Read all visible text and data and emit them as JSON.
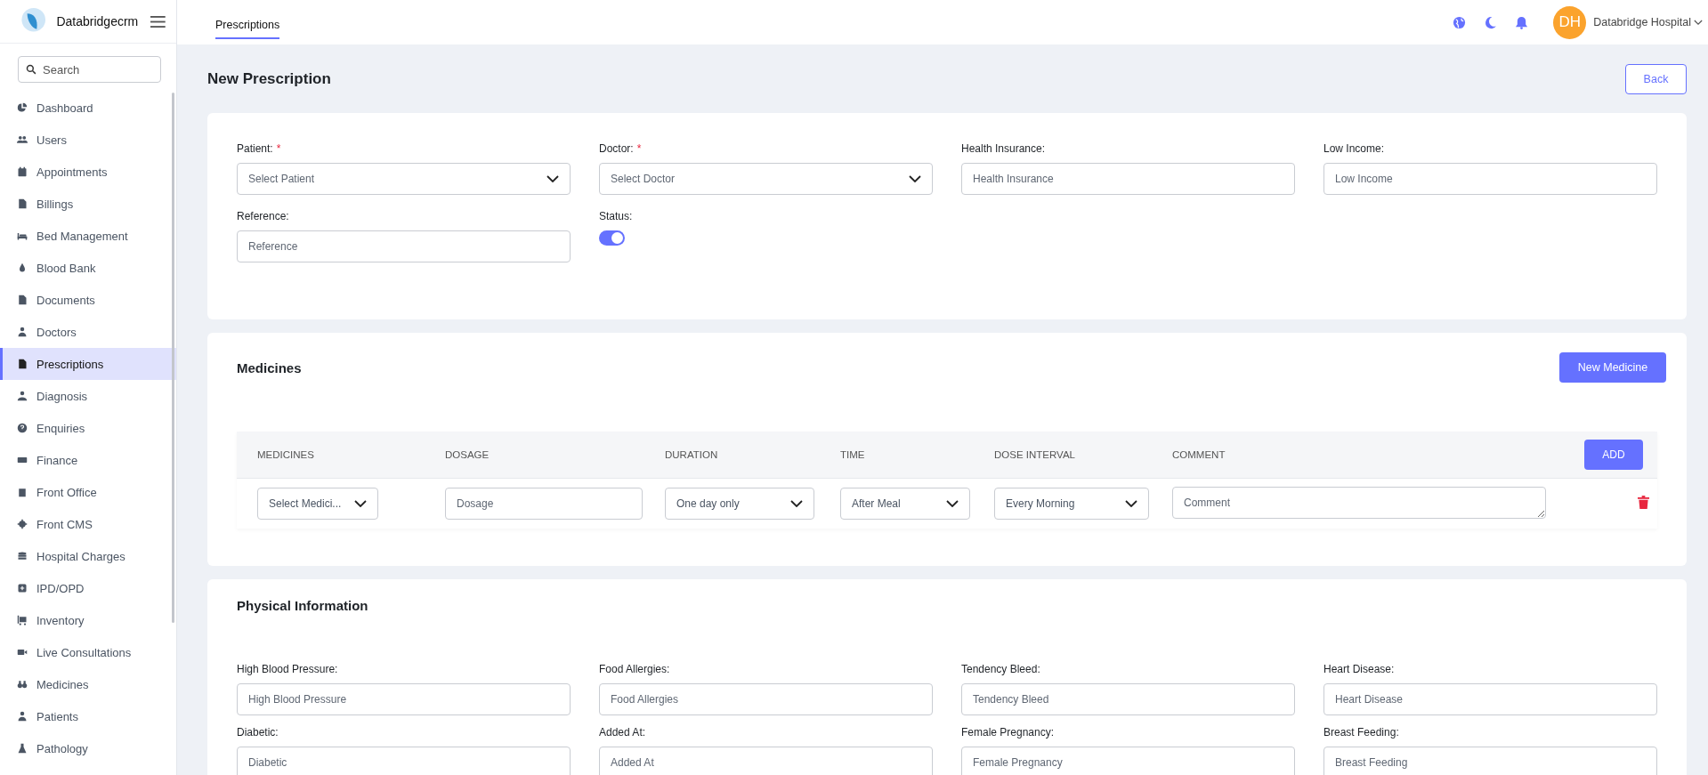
{
  "sidebar": {
    "brand": "Databridgecrm",
    "search": {
      "placeholder": "Search"
    },
    "items": [
      {
        "label": "Dashboard",
        "selected": false
      },
      {
        "label": "Users",
        "selected": false
      },
      {
        "label": "Appointments",
        "selected": false
      },
      {
        "label": "Billings",
        "selected": false
      },
      {
        "label": "Bed Management",
        "selected": false
      },
      {
        "label": "Blood Bank",
        "selected": false
      },
      {
        "label": "Documents",
        "selected": false
      },
      {
        "label": "Doctors",
        "selected": false
      },
      {
        "label": "Prescriptions",
        "selected": true
      },
      {
        "label": "Diagnosis",
        "selected": false
      },
      {
        "label": "Enquiries",
        "selected": false
      },
      {
        "label": "Finance",
        "selected": false
      },
      {
        "label": "Front Office",
        "selected": false
      },
      {
        "label": "Front CMS",
        "selected": false
      },
      {
        "label": "Hospital Charges",
        "selected": false
      },
      {
        "label": "IPD/OPD",
        "selected": false
      },
      {
        "label": "Inventory",
        "selected": false
      },
      {
        "label": "Live Consultations",
        "selected": false
      },
      {
        "label": "Medicines",
        "selected": false
      },
      {
        "label": "Patients",
        "selected": false
      },
      {
        "label": "Pathology",
        "selected": false
      }
    ]
  },
  "topbar": {
    "tabs": [
      {
        "label": "Prescriptions",
        "selected": true
      }
    ],
    "user": {
      "initials": "DH",
      "name": "Databridge Hospital"
    }
  },
  "page": {
    "title": "New Prescription",
    "back_button": "Back"
  },
  "prescription_form": {
    "required_mark": "*",
    "fields": [
      {
        "kind": "select",
        "label": "Patient:",
        "required": true,
        "placeholder": "Select Patient"
      },
      {
        "kind": "select",
        "label": "Doctor:",
        "required": true,
        "placeholder": "Select Doctor"
      },
      {
        "kind": "input",
        "label": "Health Insurance:",
        "required": false,
        "placeholder": "Health Insurance"
      },
      {
        "kind": "input",
        "label": "Low Income:",
        "required": false,
        "placeholder": "Low Income"
      },
      {
        "kind": "input",
        "label": "Reference:",
        "required": false,
        "placeholder": "Reference"
      },
      {
        "kind": "toggle",
        "label": "Status:",
        "required": false,
        "on": true
      }
    ]
  },
  "medicines": {
    "title": "Medicines",
    "new_button": "New Medicine",
    "columns": [
      "MEDICINES",
      "DOSAGE",
      "DURATION",
      "TIME",
      "DOSE INTERVAL",
      "COMMENT"
    ],
    "add_button": "ADD",
    "rows": [
      {
        "cells": [
          {
            "kind": "select",
            "value": "Select Medici..."
          },
          {
            "kind": "input",
            "placeholder": "Dosage"
          },
          {
            "kind": "select",
            "value": "One day only"
          },
          {
            "kind": "select",
            "value": "After Meal"
          },
          {
            "kind": "select",
            "value": "Every Morning"
          },
          {
            "kind": "textarea",
            "placeholder": "Comment"
          }
        ]
      }
    ]
  },
  "physical_information": {
    "title": "Physical Information",
    "fields": [
      {
        "label": "High Blood Pressure:",
        "placeholder": "High Blood Pressure"
      },
      {
        "label": "Food Allergies:",
        "placeholder": "Food Allergies"
      },
      {
        "label": "Tendency Bleed:",
        "placeholder": "Tendency Bleed"
      },
      {
        "label": "Heart Disease:",
        "placeholder": "Heart Disease"
      },
      {
        "label": "Diabetic:",
        "placeholder": "Diabetic"
      },
      {
        "label": "Added At:",
        "placeholder": "Added At"
      },
      {
        "label": "Female Pregnancy:",
        "placeholder": "Female Pregnancy"
      },
      {
        "label": "Breast Feeding:",
        "placeholder": "Breast Feeding"
      }
    ]
  }
}
